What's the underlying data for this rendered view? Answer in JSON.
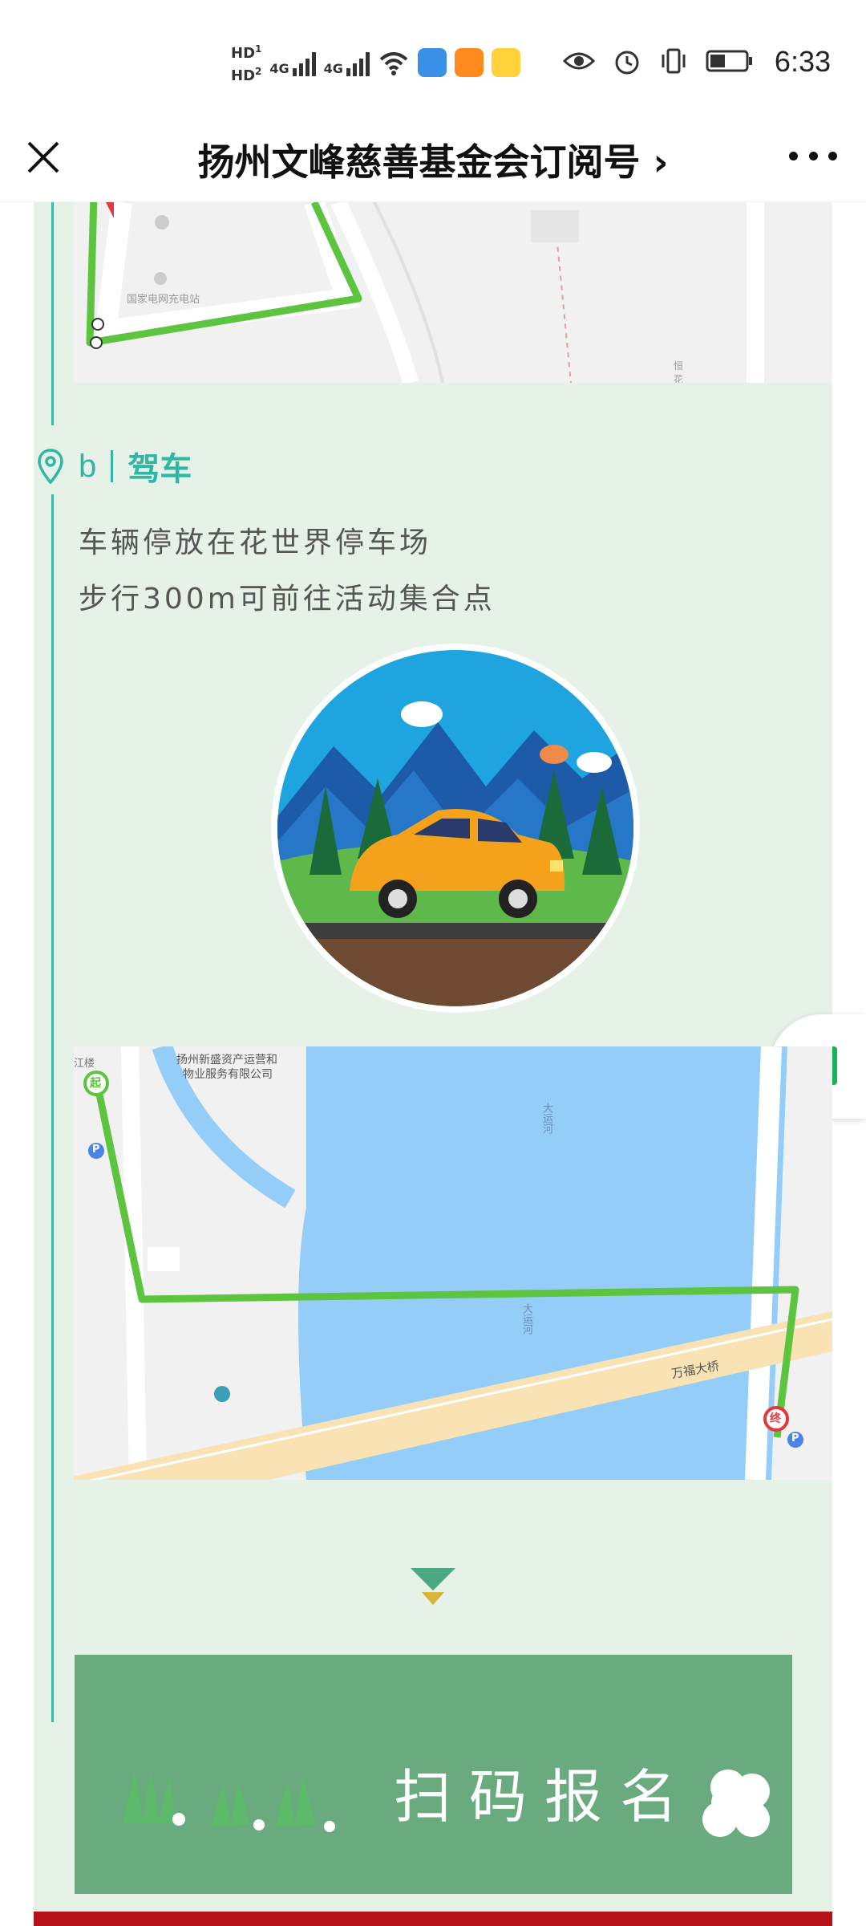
{
  "status_bar": {
    "hd1": "HD",
    "hd1_sub": "1",
    "hd2": "HD",
    "hd2_sub": "2",
    "net1": "4G",
    "net2": "4G",
    "time": "6:33"
  },
  "header": {
    "title": "扬州文峰慈善基金会订阅号",
    "chevron": "›"
  },
  "section_b": {
    "letter": "b",
    "mode": "驾车",
    "line1": "车辆停放在花世界停车场",
    "line2": "步行300m可前往活动集合点"
  },
  "map1": {
    "poi": "国家电网充电站",
    "side": "恒\n花"
  },
  "map2": {
    "company_line1": "扬州新盛资产运营和",
    "company_line2": "物业服务有限公司",
    "river1": "大运河",
    "river2": "大运河",
    "bridge": "万福大桥",
    "start": "起",
    "end": "终",
    "edge": "江楼",
    "parking": "P"
  },
  "signup": {
    "label": "扫码报名"
  },
  "colors": {
    "accent": "#2fb7a5",
    "panel_bg": "#e6f1e7",
    "signup_bg": "#69aa7e",
    "route": "#5cc43f"
  }
}
